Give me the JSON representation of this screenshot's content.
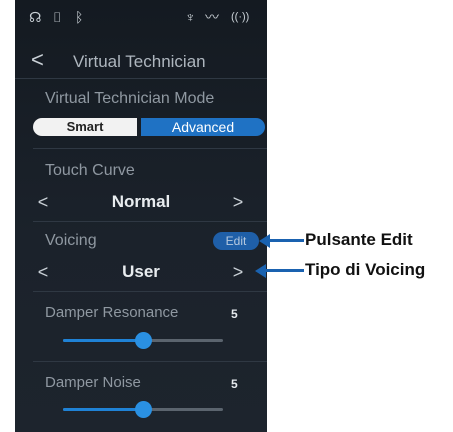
{
  "status_bar": {
    "icons": [
      "headphones-icon",
      "usb-icon",
      "bluetooth-icon",
      "microphone-icon",
      "wave-icon",
      "wireless-icon"
    ],
    "glyphs": {
      "headphones": "☊",
      "usb": "⌷",
      "bluetooth": "ᛒ",
      "microphone": "♆",
      "wave": "〰",
      "wireless": "((·))"
    }
  },
  "header": {
    "back": "<",
    "title": "Virtual Technician"
  },
  "mode": {
    "label": "Virtual Technician Mode",
    "options": [
      "Smart",
      "Advanced"
    ],
    "selected": "Advanced"
  },
  "touch_curve": {
    "label": "Touch Curve",
    "value": "Normal",
    "prev": "<",
    "next": ">"
  },
  "voicing": {
    "label": "Voicing",
    "edit_label": "Edit",
    "value": "User",
    "prev": "<",
    "next": ">"
  },
  "damper_resonance": {
    "label": "Damper Resonance",
    "value": "5",
    "fraction": 0.5
  },
  "damper_noise": {
    "label": "Damper Noise",
    "value": "5",
    "fraction": 0.5
  },
  "callouts": {
    "edit": "Pulsante Edit",
    "voicing_type": "Tipo di Voicing"
  },
  "colors": {
    "accent": "#1f72c4",
    "callout": "#1a62b0",
    "screen_bg": "#161c23"
  }
}
